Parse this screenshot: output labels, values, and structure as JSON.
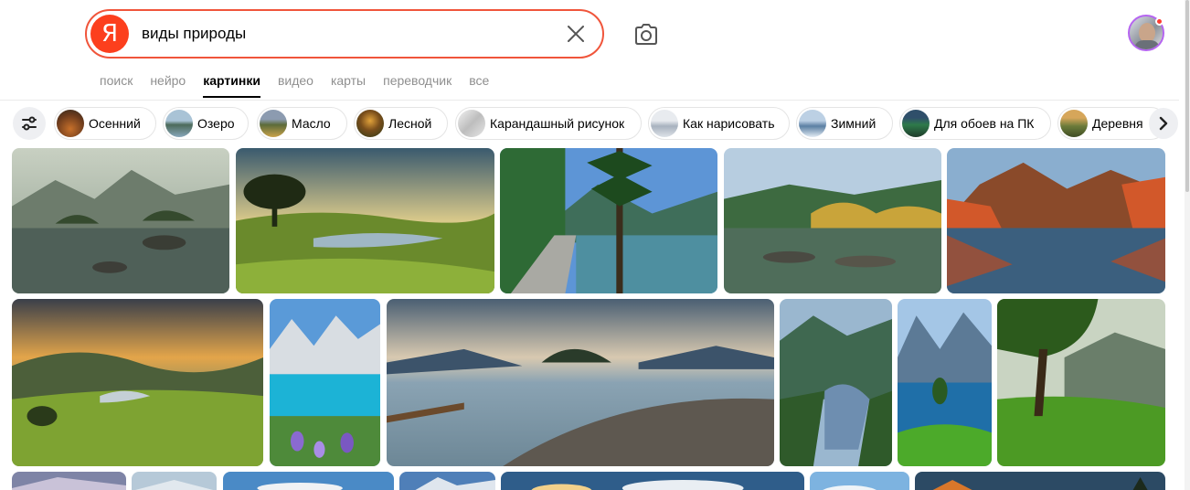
{
  "search": {
    "logo_letter": "Я",
    "query": "виды природы",
    "accent": "#f0553b",
    "logo_color": "#fc3f1d",
    "clear_icon": "close-icon",
    "camera_icon": "camera-icon"
  },
  "tabs": [
    {
      "label": "поиск",
      "active": false
    },
    {
      "label": "нейро",
      "active": false
    },
    {
      "label": "картинки",
      "active": true
    },
    {
      "label": "видео",
      "active": false
    },
    {
      "label": "карты",
      "active": false
    },
    {
      "label": "переводчик",
      "active": false
    },
    {
      "label": "все",
      "active": false
    }
  ],
  "chips": [
    {
      "label": "Осенний"
    },
    {
      "label": "Озеро"
    },
    {
      "label": "Масло"
    },
    {
      "label": "Лесной"
    },
    {
      "label": "Карандашный рисунок"
    },
    {
      "label": "Как нарисовать"
    },
    {
      "label": "Зимний"
    },
    {
      "label": "Для обоев на ПК"
    },
    {
      "label": "Деревня"
    }
  ],
  "icons": {
    "filters": "sliders-icon",
    "next": "chevron-right-icon"
  }
}
